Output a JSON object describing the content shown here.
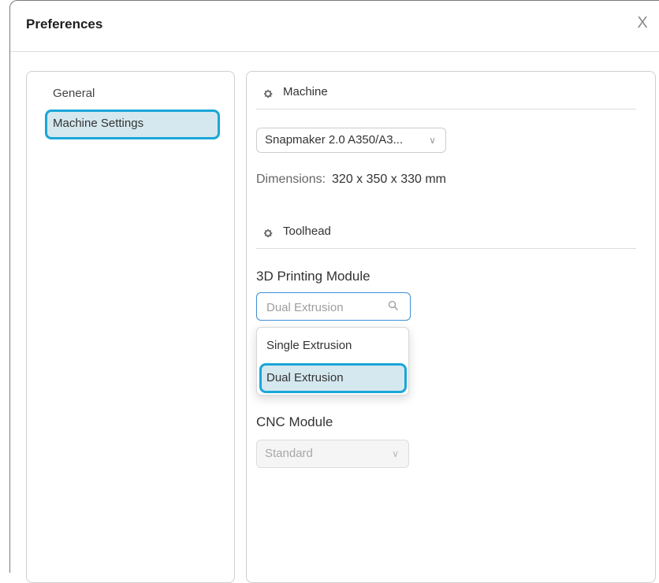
{
  "dialog": {
    "title": "Preferences",
    "close_glyph": "X"
  },
  "sidebar": {
    "items": [
      {
        "label": "General",
        "selected": false
      },
      {
        "label": "Machine Settings",
        "selected": true
      }
    ]
  },
  "machine": {
    "section_title": "Machine",
    "select_value": "Snapmaker 2.0 A350/A3...",
    "dimensions_label": "Dimensions:",
    "dimensions_value": "320 x 350 x 330 mm"
  },
  "toolhead": {
    "section_title": "Toolhead",
    "printing_module": {
      "label": "3D Printing Module",
      "search_placeholder": "Dual Extrusion",
      "options": [
        "Single Extrusion",
        "Dual Extrusion"
      ],
      "highlighted_option": "Dual Extrusion"
    },
    "cnc_module": {
      "label": "CNC Module",
      "value": "Standard",
      "disabled": true
    }
  },
  "colors": {
    "accent": "#1aa6d9",
    "selected_bg": "#d5e8ef",
    "focus_border": "#3e8fd6"
  }
}
